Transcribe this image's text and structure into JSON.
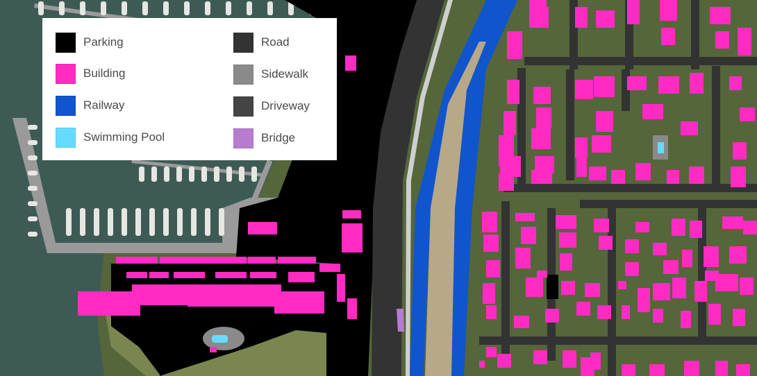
{
  "legend": {
    "items": [
      {
        "label": "Parking",
        "color": "#000000",
        "icon": "parking-swatch"
      },
      {
        "label": "Building",
        "color": "#ff2bc2",
        "icon": "building-swatch"
      },
      {
        "label": "Railway",
        "color": "#1155cc",
        "icon": "railway-swatch"
      },
      {
        "label": "Swimming Pool",
        "color": "#66dbff",
        "icon": "swimming-pool-swatch"
      },
      {
        "label": "Road",
        "color": "#333333",
        "icon": "road-swatch"
      },
      {
        "label": "Sidewalk",
        "color": "#8a8a8a",
        "icon": "sidewalk-swatch"
      },
      {
        "label": "Driveway",
        "color": "#444444",
        "icon": "driveway-swatch"
      },
      {
        "label": "Bridge",
        "color": "#b77ccf",
        "icon": "bridge-swatch"
      }
    ]
  },
  "map": {
    "colors": {
      "water": "#3e5a55",
      "vegetation": "#5a6b3c",
      "grass": "#7d8a4e",
      "dirt": "#b7a888",
      "dock": "#9a9a9a",
      "boat": "#e6e6e2"
    }
  }
}
